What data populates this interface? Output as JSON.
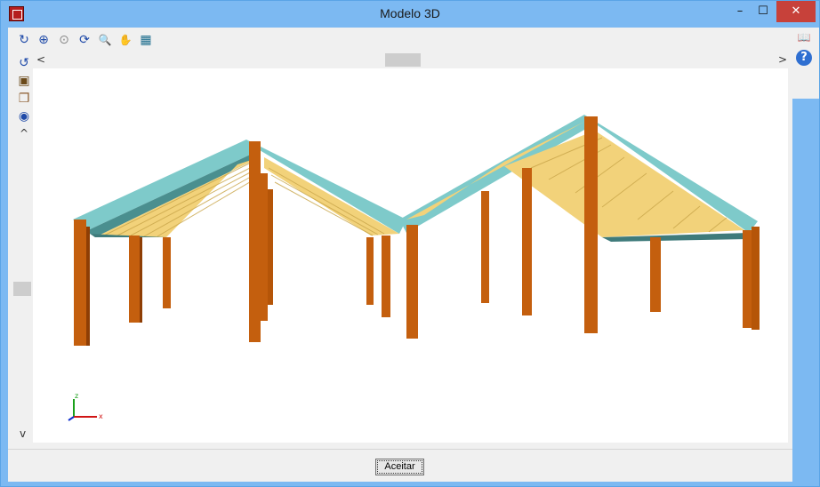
{
  "window": {
    "title": "Modelo 3D"
  },
  "titlebar_controls": {
    "minimize": "–",
    "maximize": "☐",
    "close": "✕"
  },
  "toolbar": {
    "items": [
      {
        "name": "rotate-icon",
        "glyph": "↻"
      },
      {
        "name": "zoom-window-icon",
        "glyph": "⊕"
      },
      {
        "name": "zoom-extents-icon",
        "glyph": "⊙"
      },
      {
        "name": "zoom-previous-icon",
        "glyph": "⟳"
      },
      {
        "name": "zoom-icon",
        "glyph": "🔍"
      },
      {
        "name": "pan-hand-icon",
        "glyph": "✋"
      },
      {
        "name": "view-icon",
        "glyph": "▦"
      }
    ]
  },
  "left_toolbar": {
    "items": [
      {
        "name": "redraw-icon",
        "glyph": "↺"
      },
      {
        "name": "solid-view-icon",
        "glyph": "▣"
      },
      {
        "name": "layers-icon",
        "glyph": "❐"
      },
      {
        "name": "eye-icon",
        "glyph": "◉"
      }
    ],
    "scroll_up": "^",
    "scroll_down": "v"
  },
  "hscroll": {
    "left": "<",
    "right": ">"
  },
  "right_toolbar": {
    "items": [
      {
        "name": "book-icon",
        "glyph": "📖"
      },
      {
        "name": "help-icon",
        "glyph": "?"
      }
    ]
  },
  "axes": {
    "x": "x",
    "z": "z"
  },
  "footer": {
    "accept_label": "Aceitar"
  },
  "colors": {
    "column": "#c45f0e",
    "column_dark": "#8e3e05",
    "roof_beam": "#7ecaca",
    "roof_beam_dark": "#4a8f8f",
    "purlin": "#f2d27a"
  }
}
